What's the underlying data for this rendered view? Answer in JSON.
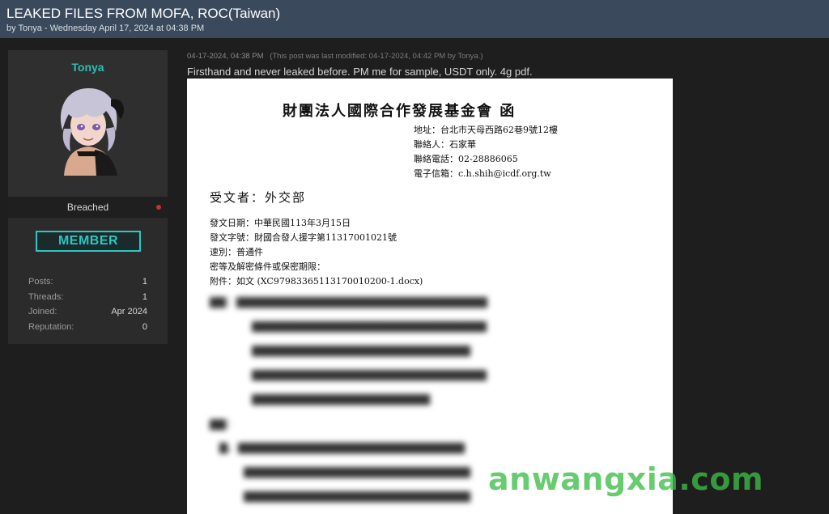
{
  "thread": {
    "title": "LEAKED FILES FROM MOFA, ROC(Taiwan)",
    "byline": "by Tonya - Wednesday April 17, 2024 at 04:38 PM"
  },
  "user": {
    "name": "Tonya",
    "rank": "Breached",
    "badge": "MEMBER",
    "avatar_icon": "anime-avatar-icon",
    "stats": [
      {
        "label": "Posts:",
        "value": "1"
      },
      {
        "label": "Threads:",
        "value": "1"
      },
      {
        "label": "Joined:",
        "value": "Apr 2024"
      },
      {
        "label": "Reputation:",
        "value": "0"
      }
    ]
  },
  "post": {
    "date": "04-17-2024, 04:38 PM",
    "modified": "(This post was last modified: 04-17-2024, 04:42 PM by Tonya.)",
    "text": "Firsthand and never leaked before.   PM me for sample, USDT only.   4g pdf."
  },
  "document": {
    "title": "財團法人國際合作發展基金會  函",
    "contact": [
      "地址：台北市天母西路62巷9號12樓",
      "聯絡人：石家華",
      "聯絡電話：02-28886065",
      "電子信箱：c.h.shih@icdf.org.tw"
    ],
    "recipient": "受文者：外交部",
    "meta": [
      "發文日期：中華民國113年3月15日",
      "發文字號：財國合發人援字第11317001021號",
      "速別：普通件",
      "密等及解密條件或保密期限：",
      "附件：如文 (XC97983365113170010200-1.docx)"
    ]
  },
  "watermark": "anwangxia.com"
}
